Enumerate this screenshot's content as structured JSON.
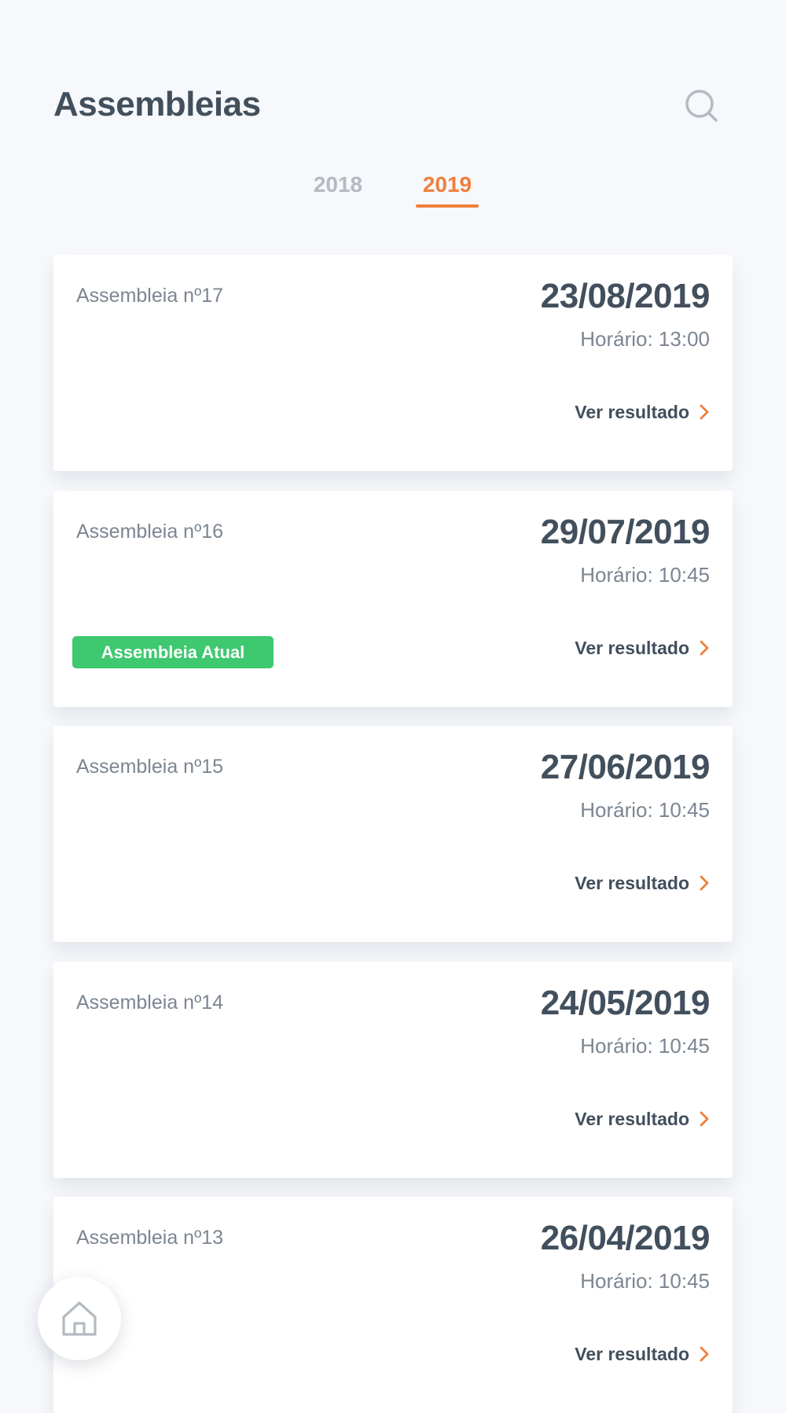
{
  "header": {
    "title": "Assembleias",
    "search_icon": "search-icon"
  },
  "tabs": [
    {
      "label": "2018",
      "active": false
    },
    {
      "label": "2019",
      "active": true
    }
  ],
  "colors": {
    "accent": "#f07f3b",
    "badge_green": "#3ec86f",
    "text_dark": "#424f5c",
    "text_muted": "#7b8692",
    "background": "#f6f8fb"
  },
  "assemblies": [
    {
      "name": "Assembleia nº17",
      "date": "23/08/2019",
      "time": "Horário: 13:00",
      "link_label": "Ver resultado"
    },
    {
      "name": "Assembleia nº16",
      "date": "29/07/2019",
      "time": "Horário: 10:45",
      "link_label": "Ver resultado",
      "badge": "Assembleia Atual"
    },
    {
      "name": "Assembleia nº15",
      "date": "27/06/2019",
      "time": "Horário: 10:45",
      "link_label": "Ver resultado"
    },
    {
      "name": "Assembleia nº14",
      "date": "24/05/2019",
      "time": "Horário: 10:45",
      "link_label": "Ver resultado"
    },
    {
      "name": "Assembleia nº13",
      "date": "26/04/2019",
      "time": "Horário: 10:45",
      "link_label": "Ver resultado"
    }
  ],
  "nav": {
    "home_icon": "home-icon"
  }
}
